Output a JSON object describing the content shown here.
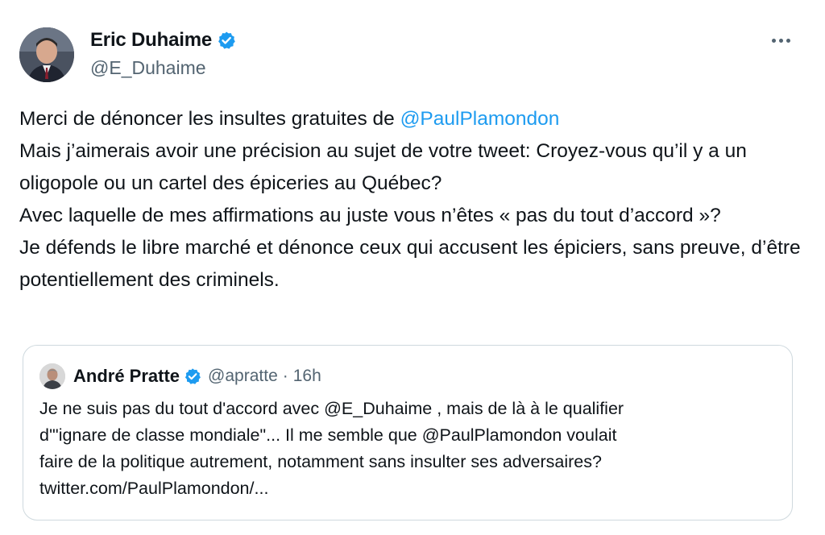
{
  "tweet": {
    "author_name": "Eric Duhaime",
    "author_handle": "@E_Duhaime",
    "verified_icon": "verified-badge-icon",
    "more_icon": "more-options-icon",
    "paragraph1_prefix": "Merci de dénoncer les insultes gratuites de ",
    "paragraph1_mention": "@PaulPlamondon",
    "paragraph2": "Mais j’aimerais avoir une précision au sujet de votre tweet: Croyez-vous qu’il y a un oligopole ou un cartel des épiceries au Québec?",
    "paragraph3": "Avec laquelle de mes affirmations au juste vous n’êtes « pas du tout d’accord »?",
    "paragraph4": "Je défends le libre marché et dénonce ceux qui accusent les épiciers, sans preuve, d’être potentiellement des criminels."
  },
  "quoted_tweet": {
    "author_name": "André Pratte",
    "author_handle": "@apratte",
    "separator": "·",
    "time": "16h",
    "line1": "Je ne suis pas du tout d'accord avec @E_Duhaime , mais de là à le qualifier",
    "line2": "d'\"ignare de classe mondiale\"... Il me semble que @PaulPlamondon voulait",
    "line3": "faire de la politique autrement, notamment sans insulter ses adversaires?",
    "line4": "twitter.com/PaulPlamondon/..."
  },
  "colors": {
    "link": "#1d9bf0",
    "secondary_text": "#536471",
    "border": "#cfd9de"
  }
}
